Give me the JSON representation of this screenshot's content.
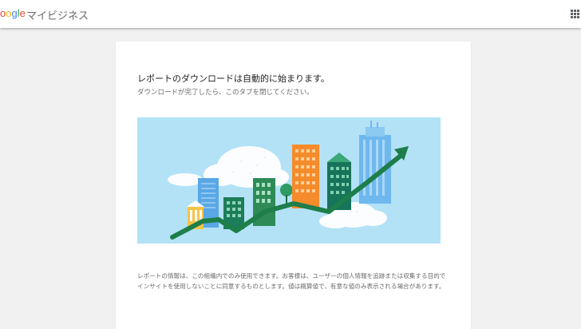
{
  "header": {
    "logo_parts": [
      "o",
      "o",
      "g",
      "l",
      "e"
    ],
    "product_name": "マイビジネス",
    "apps_icon": "apps-grid-icon"
  },
  "main": {
    "title": "レポートのダウンロードは自動的に始まります。",
    "subtitle": "ダウンロードが完了したら、このタブを閉じてください。",
    "illustration_icon": "growth-city-illustration",
    "notice": "レポートの情報は、この組織内でのみ使用できます。お客様は、ユーザーの個人情報を追跡または収集する目的でインサイトを使用しないことに同意するものとします。値は概算値で、有意な値のみ表示される場合があります。"
  },
  "colors": {
    "google_blue": "#4285f4",
    "google_red": "#ea4335",
    "google_yellow": "#fbbc05",
    "google_green": "#34a853",
    "sky": "#b3e2f7",
    "arrow_green": "#1e7e4a"
  }
}
